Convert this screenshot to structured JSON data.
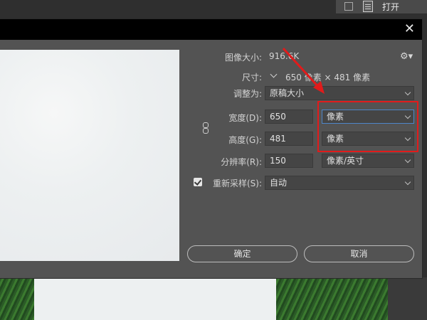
{
  "top_panel": {
    "open_label": "打开"
  },
  "dialog": {
    "close_symbol": "✕",
    "image_size": {
      "label": "图像大小:",
      "value": "916.6K"
    },
    "dimensions": {
      "label": "尺寸:",
      "value": "650 像素 × 481 像素"
    },
    "fit_to": {
      "label": "调整为:",
      "value": "原稿大小"
    },
    "width": {
      "label": "宽度(D):",
      "value": "650",
      "unit": "像素"
    },
    "height": {
      "label": "高度(G):",
      "value": "481",
      "unit": "像素"
    },
    "resolution": {
      "label": "分辨率(R):",
      "value": "150",
      "unit": "像素/英寸"
    },
    "resample": {
      "label": "重新采样(S):",
      "value": "自动",
      "checked": true
    },
    "ok_label": "确定",
    "cancel_label": "取消"
  },
  "icons": {
    "gear": "gear-icon",
    "link": "link-icon",
    "close": "close-icon",
    "chevron": "chevron-down-icon"
  },
  "colors": {
    "dialog_bg": "#535353",
    "highlight": "#e11b1b",
    "focus": "#4e86c8"
  }
}
